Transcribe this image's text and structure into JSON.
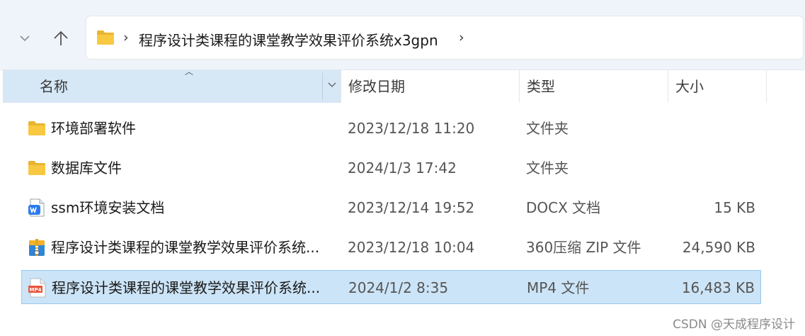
{
  "toolbar": {
    "back_icon": "chevron-down-icon",
    "up_icon": "up-arrow-icon"
  },
  "address_bar": {
    "separator": "›",
    "path_segment": "程序设计类课程的课堂教学效果评价系统x3gpn",
    "trailing_separator": "›"
  },
  "columns": {
    "name": "名称",
    "date": "修改日期",
    "type": "类型",
    "size": "大小"
  },
  "files": [
    {
      "name": "环境部署软件",
      "date": "2023/12/18 11:20",
      "type": "文件夹",
      "size": "",
      "icon": "folder-icon"
    },
    {
      "name": "数据库文件",
      "date": "2024/1/3 17:42",
      "type": "文件夹",
      "size": "",
      "icon": "folder-icon"
    },
    {
      "name": "ssm环境安装文档",
      "date": "2023/12/14 19:52",
      "type": "DOCX 文档",
      "size": "15 KB",
      "icon": "wps-doc-icon"
    },
    {
      "name": "程序设计类课程的课堂教学效果评价系统...",
      "date": "2023/12/18 10:04",
      "type": "360压缩 ZIP 文件",
      "size": "24,590 KB",
      "icon": "zip-archive-icon"
    },
    {
      "name": "程序设计类课程的课堂教学效果评价系统...",
      "date": "2024/1/2 8:35",
      "type": "MP4 文件",
      "size": "16,483 KB",
      "icon": "mp4-file-icon",
      "mp4_label": "MP4"
    }
  ],
  "colors": {
    "selection_bg": "#cce4f7",
    "header_active_bg": "#d6e7f6",
    "folder_yellow": "#f8c840"
  },
  "watermark": "CSDN @天成程序设计"
}
